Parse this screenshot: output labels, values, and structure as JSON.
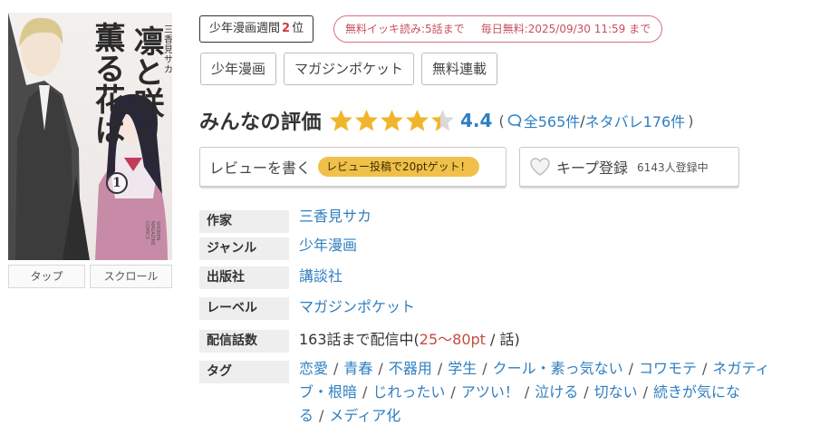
{
  "cover": {
    "title_line1": "薫る花は",
    "title_line2": "凛と咲く",
    "author": "三香見サカ",
    "volume": "1",
    "publisher_text": "SHONEN MAGAZINE COMICS"
  },
  "cover_buttons": {
    "tap": "タップ",
    "scroll": "スクロール"
  },
  "ranking": {
    "prefix": "少年漫画週間",
    "rank": "2",
    "suffix": "位"
  },
  "free_info": {
    "binge": "無料イッキ読み:5話まで",
    "daily": "毎日無料:2025/09/30 11:59 まで"
  },
  "category_tags": [
    "少年漫画",
    "マガジンポケット",
    "無料連載"
  ],
  "rating": {
    "heading": "みんなの評価",
    "value": "4.4",
    "stars_value": 4.4,
    "star_color": "#f1b52b",
    "star_empty_color": "#d9d9d9",
    "reviews_link": "全565件",
    "spoilers_link": "ネタバレ176件"
  },
  "review_button": {
    "label": "レビューを書く",
    "badge": "レビュー投稿で20ptゲット！"
  },
  "keep_button": {
    "label": "キープ登録",
    "count": "6143人登録中"
  },
  "info": {
    "author_label": "作家",
    "author": "三香見サカ",
    "genre_label": "ジャンル",
    "genre": "少年漫画",
    "publisher_label": "出版社",
    "publisher": "講談社",
    "label_label": "レーベル",
    "label": "マガジンポケット",
    "episodes_label": "配信話数",
    "episodes_prefix": "163話まで配信中(",
    "episodes_price": "25〜80pt",
    "episodes_suffix": " / 話)",
    "tags_label": "タグ"
  },
  "tags": [
    "恋愛",
    "青春",
    "不器用",
    "学生",
    "クール・素っ気ない",
    "コワモテ",
    "ネガティブ・根暗",
    "じれったい",
    "アツい！",
    "泣ける",
    "切ない",
    "続きが気になる",
    "メディア化"
  ],
  "colors": {
    "link": "#2f7fc1",
    "rank_red": "#d23b3b",
    "free_pink": "#c9505e",
    "badge_yellow": "#f0c04a"
  }
}
